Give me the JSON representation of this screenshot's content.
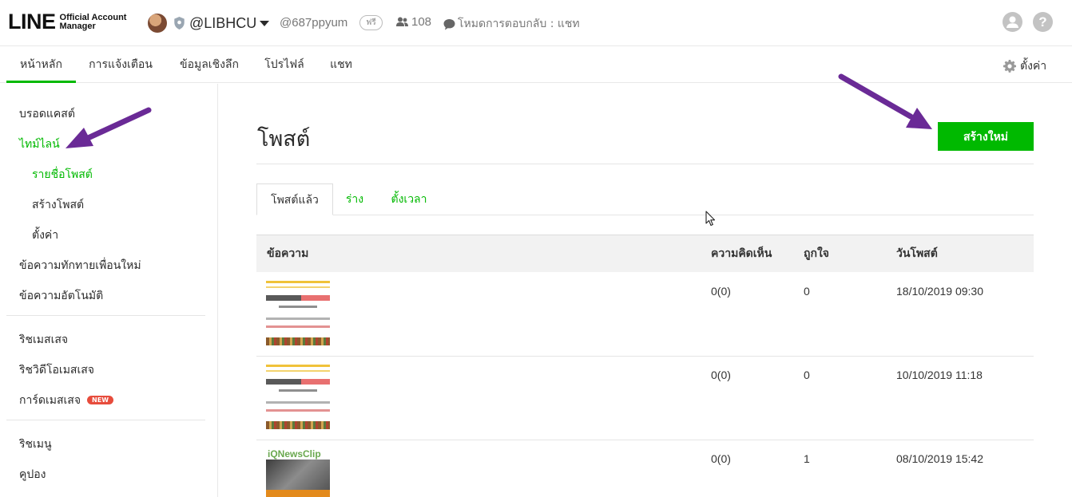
{
  "header": {
    "logo_text": "LINE",
    "logo_sub_line1": "Official Account",
    "logo_sub_line2": "Manager",
    "account_name": "@LIBHCU",
    "account_id": "@687ppyum",
    "plan_badge": "ฟรี",
    "friends_count": "108",
    "reply_mode": "โหมดการตอบกลับ : แชท",
    "help_glyph": "?"
  },
  "nav": {
    "tabs": [
      {
        "label": "หน้าหลัก"
      },
      {
        "label": "การแจ้งเตือน"
      },
      {
        "label": "ข้อมูลเชิงลึก"
      },
      {
        "label": "โปรไฟล์"
      },
      {
        "label": "แชท"
      }
    ],
    "settings_label": "ตั้งค่า"
  },
  "sidebar": {
    "broadcast": "บรอดแคสต์",
    "timeline": "ไทม์ไลน์",
    "post_list": "รายชื่อโพสต์",
    "create_post": "สร้างโพสต์",
    "settings": "ตั้งค่า",
    "greeting": "ข้อความทักทายเพื่อนใหม่",
    "auto_reply": "ข้อความอัตโนมัติ",
    "rich_message": "ริชเมสเสจ",
    "rich_video": "ริชวิดีโอเมสเสจ",
    "card_message": "การ์ดเมสเสจ",
    "new_badge": "NEW",
    "rich_menu": "ริชเมนู",
    "coupon": "คูปอง"
  },
  "main": {
    "title": "โพสต์",
    "create_button": "สร้างใหม่",
    "subtabs": [
      "โพสต์แล้ว",
      "ร่าง",
      "ตั้งเวลา"
    ],
    "columns": [
      "ข้อความ",
      "ความคิดเห็น",
      "ถูกใจ",
      "วันโพสต์"
    ],
    "rows": [
      {
        "comments": "0(0)",
        "likes": "0",
        "date": "18/10/2019 09:30"
      },
      {
        "comments": "0(0)",
        "likes": "0",
        "date": "10/10/2019 11:18"
      },
      {
        "comments": "0(0)",
        "likes": "1",
        "date": "08/10/2019 15:42"
      }
    ],
    "thumb_news_label": "iQNewsClip"
  },
  "colors": {
    "brand_green": "#00b900",
    "annotation_arrow": "#6a2a96"
  }
}
